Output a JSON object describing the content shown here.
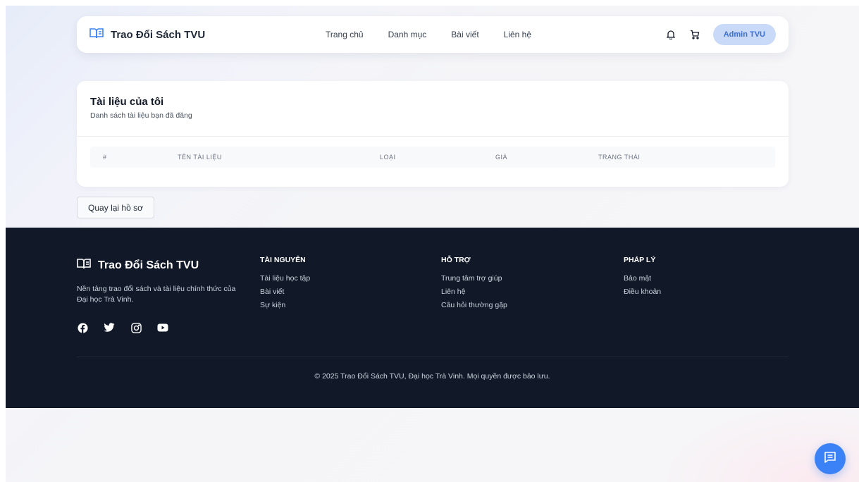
{
  "navbar": {
    "brand": "Trao Đổi Sách TVU",
    "links": [
      "Trang chủ",
      "Danh mục",
      "Bài viết",
      "Liên hệ"
    ],
    "user_button": "Admin TVU"
  },
  "card": {
    "title": "Tài liệu của tôi",
    "subtitle": "Danh sách tài liệu bạn đã đăng",
    "columns": [
      "#",
      "TÊN TÀI LIỆU",
      "LOẠI",
      "GIÁ",
      "TRẠNG THÁI"
    ]
  },
  "back_button": "Quay lại hồ sơ",
  "footer": {
    "brand": "Trao Đổi Sách TVU",
    "description": "Nền tảng trao đổi sách và tài liệu chính thức của Đại học Trà Vinh.",
    "columns": [
      {
        "title": "TÀI NGUYÊN",
        "items": [
          "Tài liệu học tập",
          "Bài viết",
          "Sự kiện"
        ]
      },
      {
        "title": "HỖ TRỢ",
        "items": [
          "Trung tâm trợ giúp",
          "Liên hệ",
          "Câu hỏi thường gặp"
        ]
      },
      {
        "title": "PHÁP LÝ",
        "items": [
          "Bảo mật",
          "Điều khoản"
        ]
      }
    ],
    "copyright": "© 2025 Trao Đổi Sách TVU, Đại học Trà Vinh. Mọi quyền được bảo lưu."
  },
  "icons": {
    "brand": "book-open-icon",
    "notifications": "bell-icon",
    "cart": "cart-icon",
    "socials": [
      "facebook-icon",
      "twitter-icon",
      "instagram-icon",
      "youtube-icon"
    ],
    "chat": "chat-icon"
  },
  "colors": {
    "accent": "#3b82f6",
    "pill_bg": "#c9daf8",
    "pill_text": "#3b6fd6",
    "footer_bg": "#111827"
  }
}
